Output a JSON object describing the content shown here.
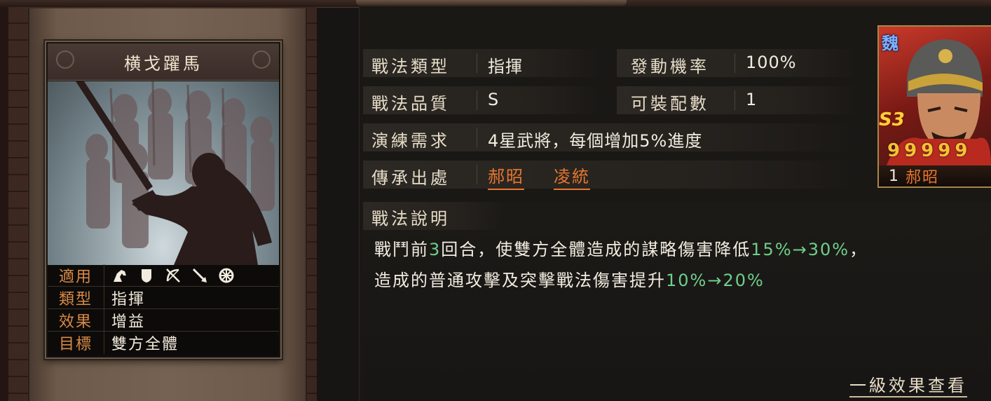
{
  "skill_card": {
    "title": "横戈躍馬",
    "troop_icons": [
      "cavalry-icon",
      "shield-icon",
      "archer-icon",
      "spear-icon",
      "siege-icon"
    ],
    "properties": [
      {
        "key": "適用",
        "value": ""
      },
      {
        "key": "類型",
        "value": "指揮"
      },
      {
        "key": "效果",
        "value": "增益"
      },
      {
        "key": "目標",
        "value": "雙方全體"
      }
    ]
  },
  "info": {
    "type_label": "戰法類型",
    "type_value": "指揮",
    "rate_label": "發動機率",
    "rate_value": "100%",
    "quality_label": "戰法品質",
    "quality_value": "S",
    "equip_label": "可裝配數",
    "equip_value": "1",
    "train_label": "演練需求",
    "train_value": "4星武將，每個增加5%進度",
    "inherit_label": "傳承出處",
    "inherit_sources": [
      "郝昭",
      "凌統"
    ]
  },
  "description": {
    "title": "戰法說明",
    "line1_a": "戰鬥前",
    "line1_b": "3",
    "line1_c": "回合，使雙方全體造成的謀略傷害降低",
    "line1_d": "15%→30%",
    "line1_e": "，",
    "line2_a": "造成的普通攻擊及突擊戰法傷害提升",
    "line2_b": "10%→20%"
  },
  "more_link": "一級效果查看",
  "general": {
    "kingdom": "魏",
    "grade": "S3",
    "stars": "99999",
    "level": "1",
    "name": "郝昭"
  },
  "colors": {
    "accent_orange": "#e8762e",
    "highlight_green": "#6fcf8b",
    "kingdom_blue": "#7fb0ff",
    "star_gold": "#f3c234"
  }
}
